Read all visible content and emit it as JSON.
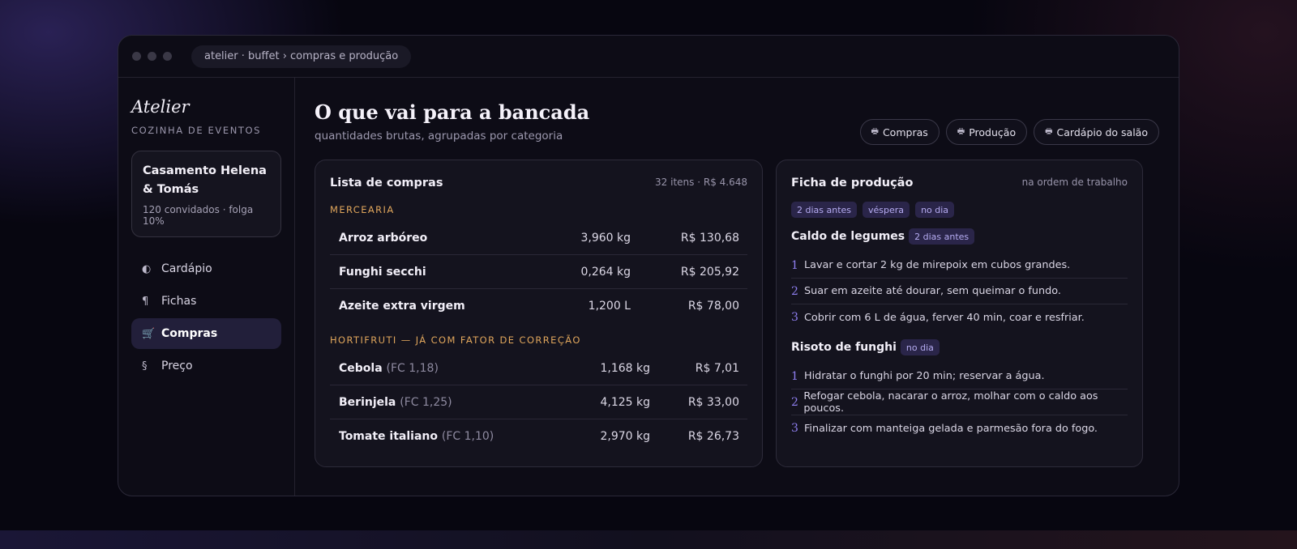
{
  "window": {
    "breadcrumb": "atelier · buffet › compras e produção"
  },
  "sidebar": {
    "logo": "Atelier",
    "subtitle": "COZINHA DE EVENTOS",
    "event": {
      "name": "Casamento Helena & Tomás",
      "meta": "120 convidados · folga 10%"
    },
    "items": [
      {
        "icon": "◐",
        "icon_name": "half-circle-icon",
        "label": "Cardápio"
      },
      {
        "icon": "¶",
        "icon_name": "pilcrow-icon",
        "label": "Fichas"
      },
      {
        "icon": "🛒",
        "icon_name": "cart-icon",
        "label": "Compras",
        "active": true
      },
      {
        "icon": "§",
        "icon_name": "section-sign-icon",
        "label": "Preço"
      }
    ]
  },
  "header": {
    "title": "O que vai para a bancada",
    "subtitle": "quantidades brutas, agrupadas por categoria",
    "actions": [
      {
        "icon": "🖶",
        "label": "Compras"
      },
      {
        "icon": "🖶",
        "label": "Produção"
      },
      {
        "icon": "🖶",
        "label": "Cardápio do salão"
      }
    ]
  },
  "shopping": {
    "title": "Lista de compras",
    "meta": "32 itens · R$ 4.648",
    "categories": [
      {
        "name": "MERCEARIA",
        "items": [
          {
            "name": "Arroz arbóreo",
            "fc": "",
            "qty": "3,960 kg",
            "price": "R$ 130,68"
          },
          {
            "name": "Funghi secchi",
            "fc": "",
            "qty": "0,264 kg",
            "price": "R$ 205,92"
          },
          {
            "name": "Azeite extra virgem",
            "fc": "",
            "qty": "1,200 L",
            "price": "R$ 78,00"
          }
        ]
      },
      {
        "name": "HORTIFRUTI — JÁ COM FATOR DE CORREÇÃO",
        "items": [
          {
            "name": "Cebola",
            "fc": "(FC 1,18)",
            "qty": "1,168 kg",
            "price": "R$ 7,01"
          },
          {
            "name": "Berinjela",
            "fc": "(FC 1,25)",
            "qty": "4,125 kg",
            "price": "R$ 33,00"
          },
          {
            "name": "Tomate italiano",
            "fc": "(FC 1,10)",
            "qty": "2,970 kg",
            "price": "R$ 26,73"
          }
        ]
      }
    ]
  },
  "production": {
    "title": "Ficha de produção",
    "meta": "na ordem de trabalho",
    "tags": [
      "2 dias antes",
      "véspera",
      "no dia"
    ],
    "recipes": [
      {
        "name": "Caldo de legumes",
        "tag": "2 dias antes",
        "steps": [
          {
            "n": "1",
            "text": "Lavar e cortar 2 kg de mirepoix em cubos grandes."
          },
          {
            "n": "2",
            "text": "Suar em azeite até dourar, sem queimar o fundo."
          },
          {
            "n": "3",
            "text": "Cobrir com 6 L de água, ferver 40 min, coar e resfriar."
          }
        ]
      },
      {
        "name": "Risoto de funghi",
        "tag": "no dia",
        "steps": [
          {
            "n": "1",
            "text": "Hidratar o funghi por 20 min; reservar a água."
          },
          {
            "n": "2",
            "text": "Refogar cebola, nacarar o arroz, molhar com o caldo aos poucos."
          },
          {
            "n": "3",
            "text": "Finalizar com manteiga gelada e parmesão fora do fogo."
          }
        ]
      }
    ]
  }
}
